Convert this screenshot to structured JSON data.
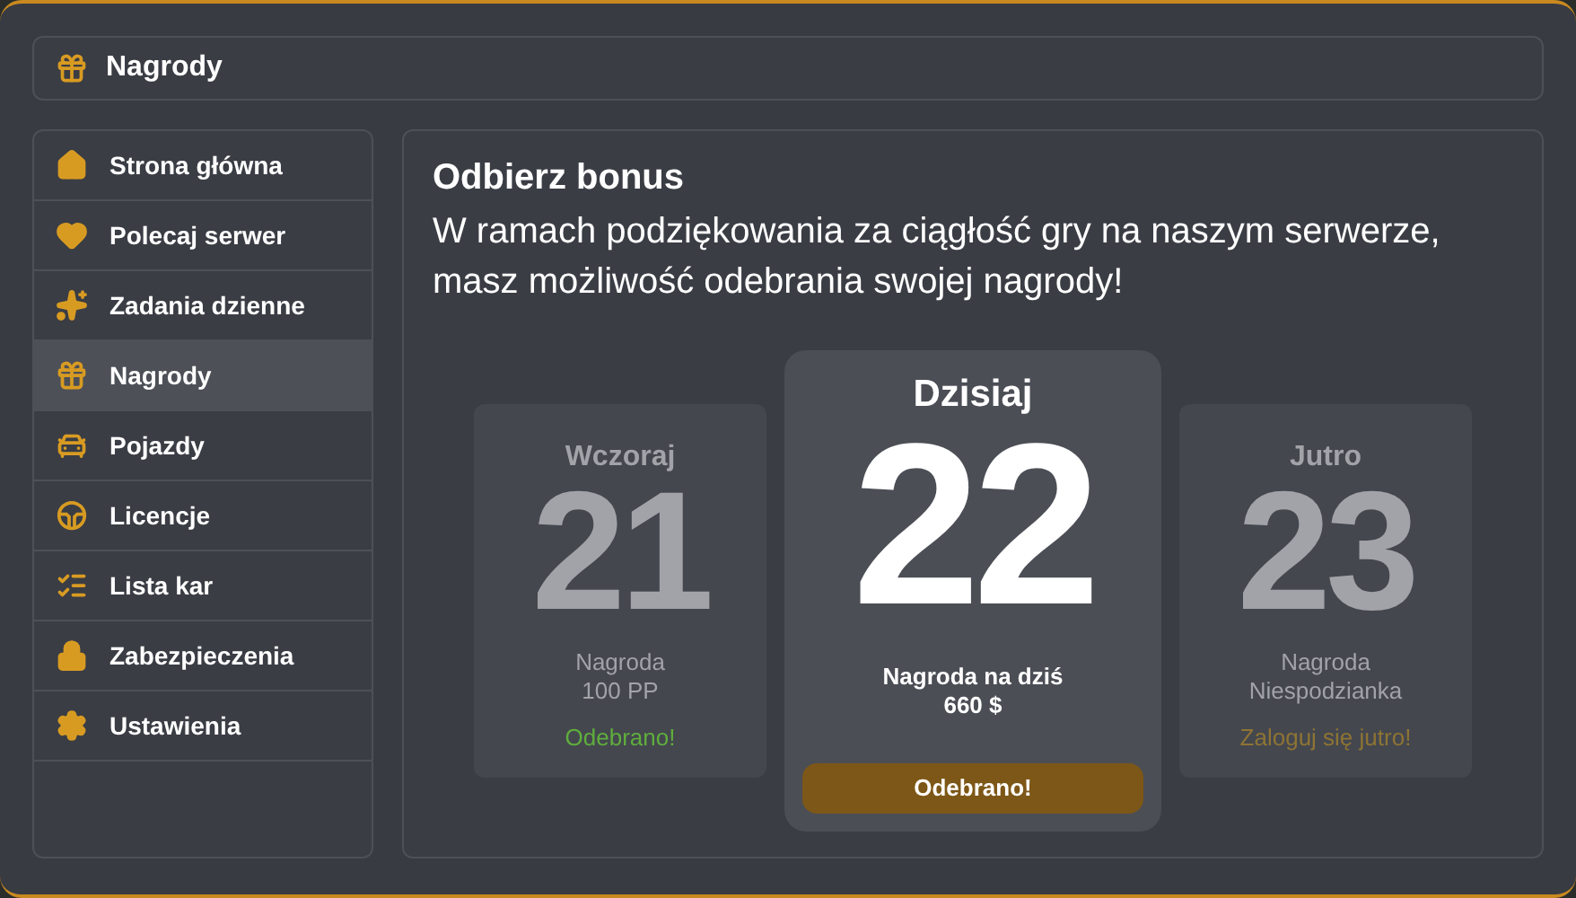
{
  "header": {
    "title": "Nagrody"
  },
  "sidebar": {
    "items": [
      {
        "label": "Strona główna",
        "selected": false
      },
      {
        "label": "Polecaj serwer",
        "selected": false
      },
      {
        "label": "Zadania dzienne",
        "selected": false
      },
      {
        "label": "Nagrody",
        "selected": true
      },
      {
        "label": "Pojazdy",
        "selected": false
      },
      {
        "label": "Licencje",
        "selected": false
      },
      {
        "label": "Lista kar",
        "selected": false
      },
      {
        "label": "Zabezpieczenia",
        "selected": false
      },
      {
        "label": "Ustawienia",
        "selected": false
      }
    ]
  },
  "main": {
    "title": "Odbierz bonus",
    "text": "W ramach podziękowania za ciągłość gry na naszym serwerze, masz możliwość odebrania swojej nagrody!",
    "cards": [
      {
        "kind": "past",
        "day": "Wczoraj",
        "number": "21",
        "reward_label": "Nagroda",
        "reward": "100 PP",
        "status": "Odebrano!"
      },
      {
        "kind": "today",
        "day": "Dzisiaj",
        "number": "22",
        "reward_label": "Nagroda na dziś",
        "reward": "660 $",
        "status": "Odebrano!"
      },
      {
        "kind": "future",
        "day": "Jutro",
        "number": "23",
        "reward_label": "Nagroda",
        "reward": "Niespodzianka",
        "status": "Zaloguj się jutro!"
      }
    ]
  }
}
